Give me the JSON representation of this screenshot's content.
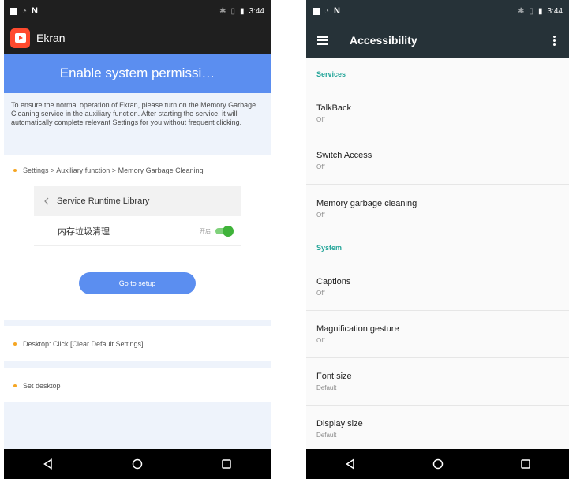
{
  "left": {
    "status": {
      "time": "3:44"
    },
    "app_title": "Ekran",
    "banner": "Enable system permissi…",
    "intro": "To ensure the normal operation of Ekran, please turn on the Memory Garbage Cleaning service in the auxiliary function. After starting the service, it will automatically complete relevant Settings for you without frequent clicking.",
    "step1": "Settings > Auxiliary function > Memory Garbage Cleaning",
    "mock": {
      "header": "Service Runtime Library",
      "row_label": "内存垃圾清理",
      "toggle_text": "开启"
    },
    "setup_button": "Go to setup",
    "step2": "Desktop: Click [Clear Default Settings]",
    "step3": "Set desktop"
  },
  "right": {
    "status": {
      "time": "3:44"
    },
    "title": "Accessibility",
    "services_header": "Services",
    "services": [
      {
        "title": "TalkBack",
        "value": "Off"
      },
      {
        "title": "Switch Access",
        "value": "Off"
      },
      {
        "title": "Memory garbage cleaning",
        "value": "Off"
      }
    ],
    "system_header": "System",
    "system": [
      {
        "title": "Captions",
        "value": "Off"
      },
      {
        "title": "Magnification gesture",
        "value": "Off"
      },
      {
        "title": "Font size",
        "value": "Default"
      },
      {
        "title": "Display size",
        "value": "Default"
      }
    ]
  },
  "colors": {
    "accent_blue": "#5b8ef0",
    "teal_header": "#26a69a",
    "toolbar_dark": "#263238",
    "toggle_green": "#3fb33a",
    "bullet_orange": "#f5a623"
  }
}
